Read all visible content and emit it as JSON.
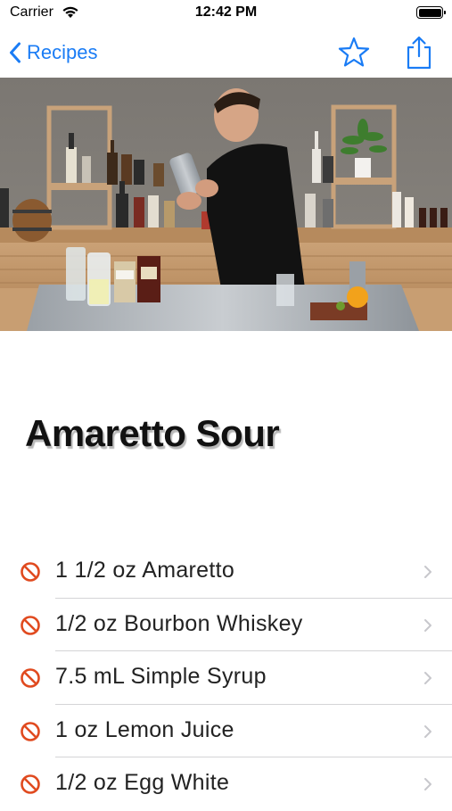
{
  "status_bar": {
    "carrier": "Carrier",
    "time": "12:42 PM"
  },
  "nav": {
    "back_label": "Recipes"
  },
  "icons": {
    "back": "chevron-left-icon",
    "favorite": "star-outline-icon",
    "share": "share-icon",
    "ingredient": "prohibited-icon",
    "disclosure": "chevron-right-icon"
  },
  "colors": {
    "accent": "#1a7cf5",
    "ingredient_icon": "#e04a1f",
    "chevron": "#c7c7cc"
  },
  "recipe": {
    "title": "Amaretto Sour",
    "ingredients": [
      "1 1/2 oz Amaretto",
      "1/2 oz Bourbon Whiskey",
      "7.5 mL Simple Syrup",
      "1 oz Lemon Juice",
      "1/2 oz Egg White"
    ]
  }
}
